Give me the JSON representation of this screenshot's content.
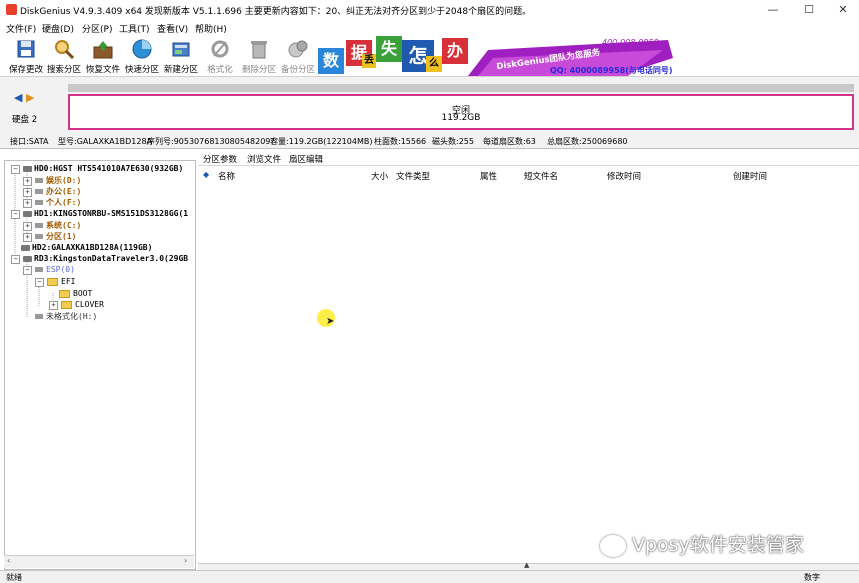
{
  "window": {
    "title": "DiskGenius V4.9.3.409 x64   发现新版本 V5.1.1.696 主要更新内容如下：20、纠正无法对齐分区到少于2048个扇区的问题。",
    "controls": [
      "—",
      "☐",
      "✕"
    ]
  },
  "menu": [
    "文件(F)",
    "硬盘(D)",
    "分区(P)",
    "工具(T)",
    "查看(V)",
    "帮助(H)"
  ],
  "toolbar": [
    {
      "label": "保存更改",
      "icon": "save-icon",
      "enabled": true
    },
    {
      "label": "搜索分区",
      "icon": "search-partition-icon",
      "enabled": true
    },
    {
      "label": "恢复文件",
      "icon": "recover-files-icon",
      "enabled": true
    },
    {
      "label": "快速分区",
      "icon": "quick-partition-icon",
      "enabled": true
    },
    {
      "label": "新建分区",
      "icon": "new-partition-icon",
      "enabled": true
    },
    {
      "label": "格式化",
      "icon": "format-icon",
      "enabled": false
    },
    {
      "label": "删除分区",
      "icon": "delete-partition-icon",
      "enabled": false
    },
    {
      "label": "备份分区",
      "icon": "backup-partition-icon",
      "enabled": false
    }
  ],
  "banner": {
    "chars": [
      "数",
      "据",
      "丢",
      "失",
      "怎",
      "么",
      "办"
    ],
    "phone": "400-008-9958",
    "brand": "DiskGenius团队为您服务",
    "qq": "QQ: 4000089958(与电话同号)"
  },
  "disk": {
    "nav_label": "硬盘 2",
    "free_label": "空闲",
    "free_size": "119.2GB"
  },
  "info": {
    "interface": "接口:SATA",
    "model": "型号:GALAXKA1BD128A",
    "serial": "序列号:9053076813080548209?",
    "capacity": "容量:119.2GB(122104MB)",
    "cylinders": "柱面数:15566",
    "heads": "磁头数:255",
    "sectors_per_track": "每道扇区数:63",
    "total_sectors": "总扇区数:250069680"
  },
  "tree": [
    {
      "text": "HD0:HGST HTS541010A7E630(932GB)",
      "level": 0,
      "kind": "disk",
      "exp": "−"
    },
    {
      "text": "娱乐(D:)",
      "level": 1,
      "kind": "part",
      "exp": "+",
      "color": "#a05a00"
    },
    {
      "text": "办公(E:)",
      "level": 1,
      "kind": "part",
      "exp": "+",
      "color": "#a05a00"
    },
    {
      "text": "个人(F:)",
      "level": 1,
      "kind": "part",
      "exp": "+",
      "color": "#a05a00"
    },
    {
      "text": "HD1:KINGSTONRBU-SMS151DS3128GG(1",
      "level": 0,
      "kind": "disk",
      "exp": "−"
    },
    {
      "text": "系统(C:)",
      "level": 1,
      "kind": "part",
      "exp": "+",
      "color": "#a05a00"
    },
    {
      "text": "分区(1)",
      "level": 1,
      "kind": "part",
      "exp": "+",
      "color": "#a05a00"
    },
    {
      "text": "HD2:GALAXKA1BD128A(119GB)",
      "level": 0,
      "kind": "disk",
      "exp": ""
    },
    {
      "text": "RD3:KingstonDataTraveler3.0(29GB",
      "level": 0,
      "kind": "disk",
      "exp": "−"
    },
    {
      "text": "ESP(0)",
      "level": 1,
      "kind": "part",
      "exp": "−",
      "color": "#5a6ad0"
    },
    {
      "text": "EFI",
      "level": 2,
      "kind": "folder",
      "exp": "−"
    },
    {
      "text": "BOOT",
      "level": 3,
      "kind": "folder",
      "exp": ""
    },
    {
      "text": "CLOVER",
      "level": 3,
      "kind": "folder",
      "exp": "+"
    },
    {
      "text": "未格式化(H:)",
      "level": 1,
      "kind": "part",
      "exp": "",
      "color": "#333"
    }
  ],
  "tabs": [
    "分区参数",
    "浏览文件",
    "扇区编辑"
  ],
  "columns": [
    "名称",
    "大小",
    "文件类型",
    "属性",
    "短文件名",
    "修改时间",
    "创建时间"
  ],
  "status": {
    "left": "就绪",
    "right": "数字"
  },
  "watermark": "Vposy软件安装管家"
}
